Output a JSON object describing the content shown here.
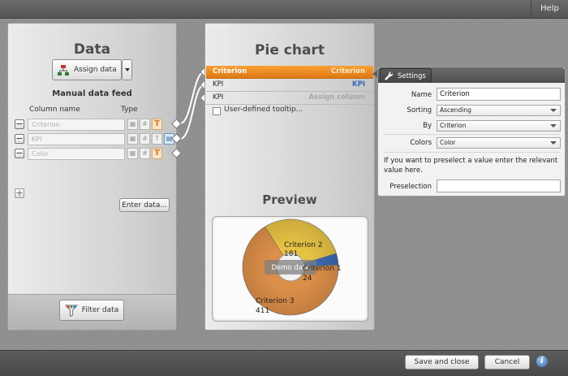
{
  "topbar": {
    "help_label": "Help"
  },
  "data_panel": {
    "title": "Data",
    "assign_label": "Assign data",
    "manual_feed_label": "Manual data feed",
    "column_name_header": "Column name",
    "type_header": "Type",
    "rows": [
      {
        "placeholder": "Criterion"
      },
      {
        "placeholder": "KPI"
      },
      {
        "placeholder": "Color"
      }
    ],
    "enter_data_label": "Enter data...",
    "filter_label": "Filter data"
  },
  "pie_panel": {
    "title": "Pie chart",
    "rows": [
      {
        "left": "Criterion",
        "right": "Criterion"
      },
      {
        "left": "KPI",
        "right": "KPI"
      },
      {
        "left": "KPI",
        "right": "Assign column"
      }
    ],
    "tooltip_label": "User-defined tooltip...",
    "preview_title": "Preview",
    "preview": {
      "overlay_label": "Demo data",
      "slices": [
        {
          "name": "Criterion 2",
          "value": "181",
          "color": "#e6c244"
        },
        {
          "name": "Criterion 1",
          "value": "24",
          "color": "#3c68b3"
        },
        {
          "name": "Criterion 3",
          "value": "411",
          "color": "#dc8f49"
        }
      ]
    }
  },
  "settings": {
    "tab_label": "Settings",
    "name_label": "Name",
    "name_value": "Criterion",
    "sorting_label": "Sorting",
    "sorting_value": "Ascending",
    "by_label": "By",
    "by_value": "Criterion",
    "colors_label": "Colors",
    "colors_value": "Color",
    "hint": "If you want to preselect a value enter the relevant value here.",
    "preselection_label": "Preselection",
    "preselection_value": ""
  },
  "footer": {
    "save_close_label": "Save and close",
    "cancel_label": "Cancel",
    "info_glyph": "i"
  },
  "colors": {
    "accent_orange": "#e98a22",
    "kpi_blue": "#3267b5"
  }
}
